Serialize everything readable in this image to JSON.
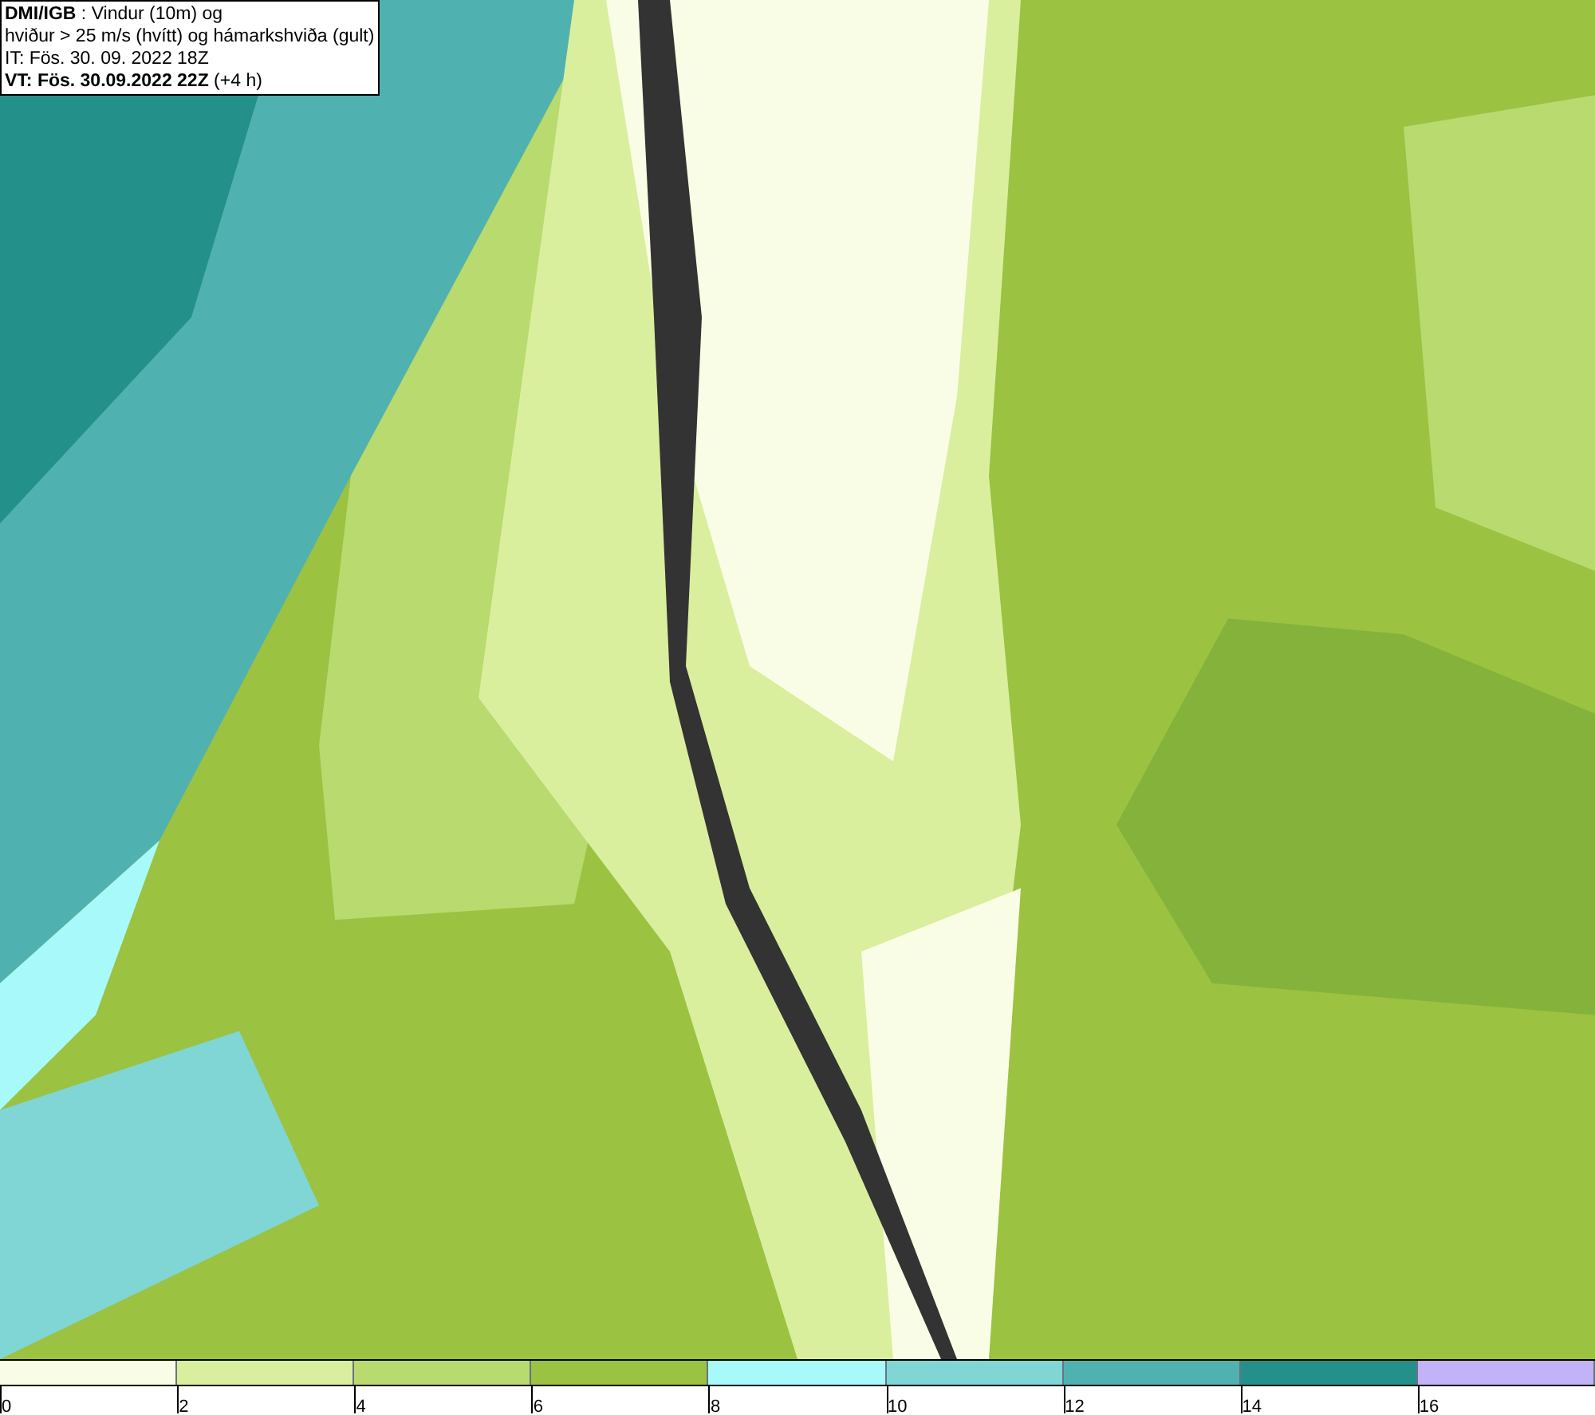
{
  "title_box": {
    "lines": [
      "**DMI/IGB** : Vindur (10m) og",
      "hviður > 25 m/s (hvítt) og hámarkshviða (gult)",
      "IT: Fös. 30. 09. 2022 18Z",
      "**VT: Fös. 30.09.2022 22Z** (+4 h)"
    ]
  },
  "legend": {
    "bins": [
      {
        "color": "#fafde6"
      },
      {
        "color": "#d9ef9e"
      },
      {
        "color": "#b8da6e"
      },
      {
        "color": "#9bc240"
      },
      {
        "color": "#a8fafa"
      },
      {
        "color": "#7fd6d4"
      },
      {
        "color": "#50b2b0"
      },
      {
        "color": "#23918a"
      },
      {
        "color": "#c2b2f8"
      }
    ],
    "ticks": [
      "0",
      "2",
      "4",
      "6",
      "8",
      "10",
      "12",
      "14",
      "16"
    ]
  }
}
